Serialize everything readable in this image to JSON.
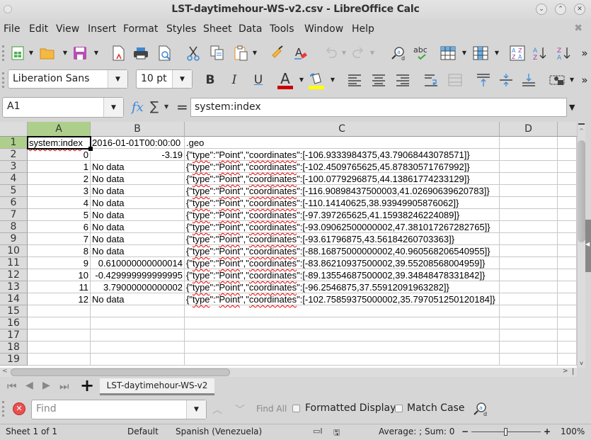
{
  "window": {
    "title": "LST-daytimehour-WS-v2.csv - LibreOffice Calc",
    "controls": [
      "minimize",
      "maximize",
      "close"
    ]
  },
  "menubar": {
    "items": [
      "File",
      "Edit",
      "View",
      "Insert",
      "Format",
      "Styles",
      "Sheet",
      "Data",
      "Tools",
      "Window",
      "Help"
    ]
  },
  "toolbar_standard": {
    "icons": [
      "new-spreadsheet-icon",
      "open-folder-icon",
      "save-icon",
      "export-pdf-icon",
      "print-icon",
      "print-preview-icon",
      "cut-icon",
      "copy-icon",
      "paste-icon",
      "clone-formatting-icon",
      "clear-formatting-icon",
      "undo-icon",
      "redo-icon",
      "find-replace-icon",
      "spelling-icon",
      "row-icon",
      "column-icon",
      "sort-icon",
      "sort-ascending-icon",
      "sort-descending-icon",
      "more-icon"
    ]
  },
  "toolbar_formatting": {
    "font_name": "Liberation Sans",
    "font_size": "10 pt",
    "bold": "B",
    "italic": "I",
    "underline": "U",
    "font_color_glyph": "A",
    "font_color": "#cc0000",
    "highlight_color": "#ffff00"
  },
  "formula_bar": {
    "name_box": "A1",
    "fx_label": "fx",
    "sigma_label": "∑",
    "equals_label": "=",
    "content": "system:index"
  },
  "sheet": {
    "columns": [
      "A",
      "B",
      "C",
      "D"
    ],
    "selected_cell": "A1",
    "rows": [
      {
        "n": "1",
        "a": "system:index",
        "b": "2016-01-01T00:00:00",
        "c": ".geo"
      },
      {
        "n": "2",
        "a": "0",
        "b": "-3.19",
        "c": "{\"type\":\"Point\",\"coordinates\":[-106.9333984375,43.79068443078571]}"
      },
      {
        "n": "3",
        "a": "1",
        "b": "No data",
        "c": "{\"type\":\"Point\",\"coordinates\":[-102.4509765625,45.87830571767992]}"
      },
      {
        "n": "4",
        "a": "2",
        "b": "No data",
        "c": "{\"type\":\"Point\",\"coordinates\":[-100.0779296875,44.13861774233129]}"
      },
      {
        "n": "5",
        "a": "3",
        "b": "No data",
        "c": "{\"type\":\"Point\",\"coordinates\":[-116.90898437500003,41.02690639620783]}"
      },
      {
        "n": "6",
        "a": "4",
        "b": "No data",
        "c": "{\"type\":\"Point\",\"coordinates\":[-110.14140625,38.93949905876062]}"
      },
      {
        "n": "7",
        "a": "5",
        "b": "No data",
        "c": "{\"type\":\"Point\",\"coordinates\":[-97.397265625,41.15938246224089]}"
      },
      {
        "n": "8",
        "a": "6",
        "b": "No data",
        "c": "{\"type\":\"Point\",\"coordinates\":[-93.09062500000002,47.381017267282765]}"
      },
      {
        "n": "9",
        "a": "7",
        "b": "No data",
        "c": "{\"type\":\"Point\",\"coordinates\":[-93.61796875,43.56184260703363]}"
      },
      {
        "n": "10",
        "a": "8",
        "b": "No data",
        "c": "{\"type\":\"Point\",\"coordinates\":[-88.16875000000002,40.960568206540955]}"
      },
      {
        "n": "11",
        "a": "9",
        "b": "0.610000000000014",
        "c": "{\"type\":\"Point\",\"coordinates\":[-83.86210937500002,39.55208568004959]}"
      },
      {
        "n": "12",
        "a": "10",
        "b": "-0.429999999999995",
        "c": "{\"type\":\"Point\",\"coordinates\":[-89.13554687500002,39.34848478331842]}"
      },
      {
        "n": "13",
        "a": "11",
        "b": "3.79000000000002",
        "c": "{\"type\":\"Point\",\"coordinates\":[-96.2546875,37.55912091963282]}"
      },
      {
        "n": "14",
        "a": "12",
        "b": "No data",
        "c": "{\"type\":\"Point\",\"coordinates\":[-102.75859375000002,35.797051250120184]}"
      },
      {
        "n": "15",
        "a": "",
        "b": "",
        "c": ""
      },
      {
        "n": "16",
        "a": "",
        "b": "",
        "c": ""
      },
      {
        "n": "17",
        "a": "",
        "b": "",
        "c": ""
      },
      {
        "n": "18",
        "a": "",
        "b": "",
        "c": ""
      },
      {
        "n": "19",
        "a": "",
        "b": "",
        "c": ""
      }
    ]
  },
  "sheet_tabs": {
    "active": "LST-daytimehour-WS-v2",
    "add_label": "+"
  },
  "find_bar": {
    "placeholder": "Find",
    "find_all": "Find All",
    "formatted_display": "Formatted Display",
    "match_case": "Match Case"
  },
  "status_bar": {
    "sheet": "Sheet 1 of 1",
    "page_style": "Default",
    "language": "Spanish (Venezuela)",
    "summary": "Average: ; Sum: 0",
    "zoom": "100%",
    "zoom_minus": "−",
    "zoom_plus": "+"
  }
}
